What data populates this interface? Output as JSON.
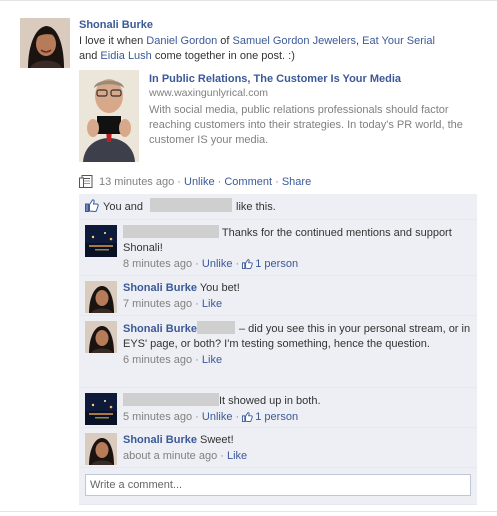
{
  "post": {
    "author": "Shonali Burke",
    "message_parts": {
      "p1": "I love it when ",
      "mention1": "Daniel Gordon",
      "p2": " of ",
      "mention2": "Samuel Gordon Jewelers",
      "p3": ", ",
      "mention3": "Eat Your Serial",
      "p4": " and ",
      "mention4": "Eidia Lush",
      "p5": " come together in one post. :)"
    },
    "attachment": {
      "title": "In Public Relations, The Customer Is Your Media",
      "url": "www.waxingunlyrical.com",
      "description": "With social media, public relations professionals should factor reaching customers into their strategies. In today's PR world, the customer IS your media."
    },
    "actions": {
      "time": "13 minutes ago",
      "sep": " · ",
      "unlike": "Unlike",
      "comment": "Comment",
      "share": "Share"
    },
    "likes": {
      "prefix": "You and",
      "suffix": "like this."
    }
  },
  "comments": [
    {
      "author": "",
      "text": "Thanks for the continued mentions and support Shonali!",
      "time": "8 minutes ago",
      "actions": [
        "Unlike"
      ],
      "like_count": "1 person"
    },
    {
      "author": "Shonali Burke",
      "text": "You bet!",
      "time": "7 minutes ago",
      "actions": [
        "Like"
      ]
    },
    {
      "author": "Shonali Burke",
      "text": "– did you see this in your personal stream, or in EYS' page, or both? I'm testing something, hence the question.",
      "time": "6 minutes ago",
      "actions": [
        "Like"
      ]
    },
    {
      "author": "",
      "text": "It showed up in both.",
      "time": "5 minutes ago",
      "actions": [
        "Unlike"
      ],
      "like_count": "1 person"
    },
    {
      "author": "Shonali Burke",
      "text": "Sweet!",
      "time": "about a minute ago",
      "actions": [
        "Like"
      ]
    }
  ],
  "composer": {
    "placeholder": "Write a comment..."
  },
  "colors": {
    "link": "#3b5998",
    "muted": "#808080",
    "ufi_bg": "#edeff4",
    "redaction": "#cfcfcf"
  },
  "icons": [
    "feed-story-icon",
    "like-thumb-icon"
  ]
}
